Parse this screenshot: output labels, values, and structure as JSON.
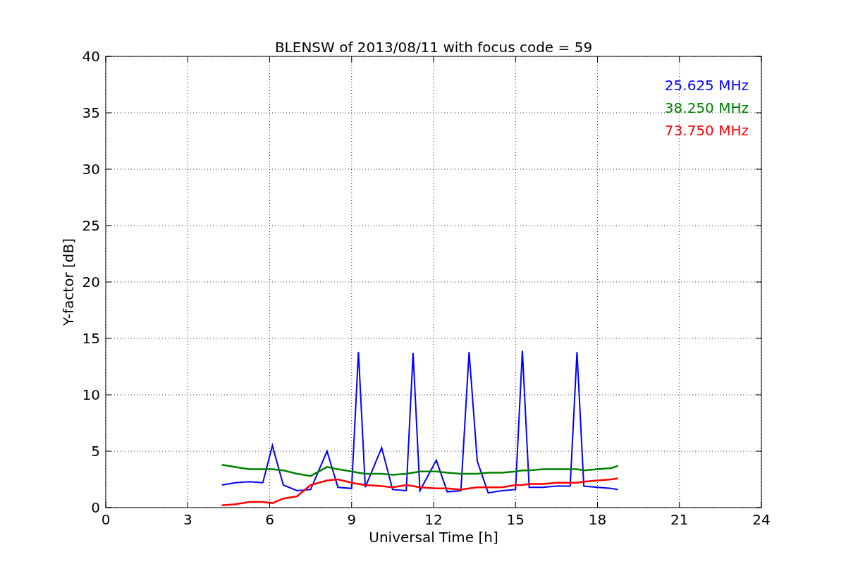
{
  "figure": {
    "chart_data": {
      "type": "line",
      "title": "BLENSW of 2013/08/11 with focus code = 59",
      "xlabel": "Universal Time [h]",
      "ylabel": "Y-factor [dB]",
      "xlim": [
        0,
        24
      ],
      "ylim": [
        0,
        40
      ],
      "xticks": [
        0,
        3,
        6,
        9,
        12,
        15,
        18,
        21,
        24
      ],
      "yticks": [
        0,
        5,
        10,
        15,
        20,
        25,
        30,
        35,
        40
      ],
      "grid": true,
      "x": [
        4.25,
        4.75,
        5.25,
        5.75,
        6.1,
        6.5,
        7.0,
        7.5,
        8.1,
        8.5,
        9.0,
        9.25,
        9.5,
        10.1,
        10.5,
        11.0,
        11.25,
        11.5,
        12.1,
        12.5,
        13.0,
        13.3,
        13.6,
        14.0,
        14.5,
        15.0,
        15.25,
        15.5,
        16.0,
        16.5,
        17.0,
        17.25,
        17.5,
        18.0,
        18.5,
        18.75
      ],
      "series": [
        {
          "name": "25.625 MHz",
          "color": "#0000ff",
          "values": [
            2,
            2.2,
            2.3,
            2.2,
            5.5,
            2,
            1.5,
            1.6,
            5,
            1.8,
            1.7,
            13.8,
            1.8,
            5.3,
            1.6,
            1.5,
            13.7,
            1.5,
            4.2,
            1.4,
            1.5,
            13.8,
            4.1,
            1.3,
            1.5,
            1.6,
            13.9,
            1.8,
            1.8,
            1.9,
            1.9,
            13.8,
            1.9,
            1.8,
            1.7,
            1.6
          ]
        },
        {
          "name": "38.250 MHz",
          "color": "#008000",
          "values": [
            3.8,
            3.6,
            3.4,
            3.4,
            3.4,
            3.3,
            3.0,
            2.8,
            3.6,
            3.4,
            3.2,
            3.1,
            3.0,
            3.0,
            2.9,
            3.0,
            3.1,
            3.2,
            3.2,
            3.1,
            3.0,
            3.0,
            3.0,
            3.1,
            3.1,
            3.2,
            3.3,
            3.3,
            3.4,
            3.4,
            3.4,
            3.4,
            3.3,
            3.4,
            3.5,
            3.7
          ]
        },
        {
          "name": "73.750 MHz",
          "color": "#ff0000",
          "values": [
            0.2,
            0.3,
            0.5,
            0.5,
            0.4,
            0.8,
            1.0,
            2.0,
            2.4,
            2.5,
            2.2,
            2.1,
            2.0,
            1.9,
            1.8,
            2.0,
            1.9,
            1.8,
            1.7,
            1.7,
            1.6,
            1.7,
            1.8,
            1.8,
            1.8,
            2.0,
            2.0,
            2.1,
            2.1,
            2.2,
            2.2,
            2.2,
            2.3,
            2.4,
            2.5,
            2.6
          ]
        }
      ]
    }
  }
}
